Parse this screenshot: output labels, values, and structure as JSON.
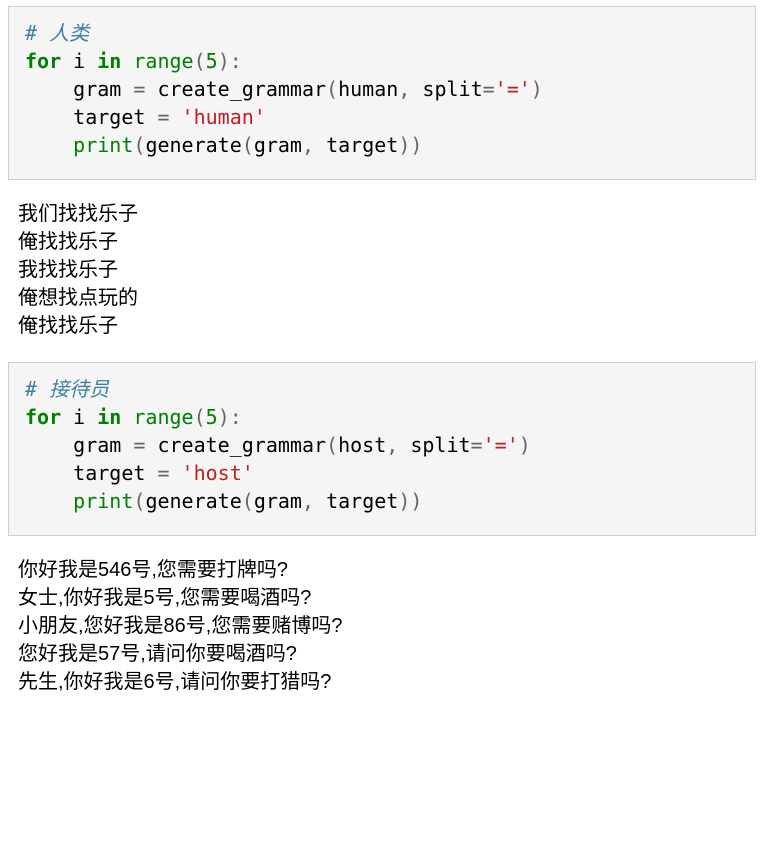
{
  "cells": [
    {
      "type": "code",
      "tokens": [
        {
          "cls": "c-comment",
          "text": "# 人类"
        },
        {
          "cls": "br"
        },
        {
          "cls": "c-keyword",
          "text": "for"
        },
        {
          "cls": "c-name",
          "text": " i "
        },
        {
          "cls": "c-keyword",
          "text": "in"
        },
        {
          "cls": "c-name",
          "text": " "
        },
        {
          "cls": "c-builtin",
          "text": "range"
        },
        {
          "cls": "c-op",
          "text": "("
        },
        {
          "cls": "c-number",
          "text": "5"
        },
        {
          "cls": "c-op",
          "text": "):"
        },
        {
          "cls": "br"
        },
        {
          "cls": "c-name",
          "text": "    gram "
        },
        {
          "cls": "c-op",
          "text": "="
        },
        {
          "cls": "c-name",
          "text": " create_grammar"
        },
        {
          "cls": "c-op",
          "text": "("
        },
        {
          "cls": "c-name",
          "text": "human"
        },
        {
          "cls": "c-op",
          "text": ","
        },
        {
          "cls": "c-name",
          "text": " split"
        },
        {
          "cls": "c-op",
          "text": "="
        },
        {
          "cls": "c-string",
          "text": "'='"
        },
        {
          "cls": "c-op",
          "text": ")"
        },
        {
          "cls": "br"
        },
        {
          "cls": "c-name",
          "text": "    target "
        },
        {
          "cls": "c-op",
          "text": "="
        },
        {
          "cls": "c-name",
          "text": " "
        },
        {
          "cls": "c-string",
          "text": "'human'"
        },
        {
          "cls": "br"
        },
        {
          "cls": "c-name",
          "text": "    "
        },
        {
          "cls": "c-builtin",
          "text": "print"
        },
        {
          "cls": "c-op",
          "text": "("
        },
        {
          "cls": "c-name",
          "text": "generate"
        },
        {
          "cls": "c-op",
          "text": "("
        },
        {
          "cls": "c-name",
          "text": "gram"
        },
        {
          "cls": "c-op",
          "text": ","
        },
        {
          "cls": "c-name",
          "text": " target"
        },
        {
          "cls": "c-op",
          "text": "))"
        }
      ]
    },
    {
      "type": "output",
      "lines": [
        "我们找找乐子",
        "俺找找乐子",
        "我找找乐子",
        "俺想找点玩的",
        "俺找找乐子"
      ]
    },
    {
      "type": "code",
      "tokens": [
        {
          "cls": "c-comment",
          "text": "# 接待员"
        },
        {
          "cls": "br"
        },
        {
          "cls": "c-keyword",
          "text": "for"
        },
        {
          "cls": "c-name",
          "text": " i "
        },
        {
          "cls": "c-keyword",
          "text": "in"
        },
        {
          "cls": "c-name",
          "text": " "
        },
        {
          "cls": "c-builtin",
          "text": "range"
        },
        {
          "cls": "c-op",
          "text": "("
        },
        {
          "cls": "c-number",
          "text": "5"
        },
        {
          "cls": "c-op",
          "text": "):"
        },
        {
          "cls": "br"
        },
        {
          "cls": "c-name",
          "text": "    gram "
        },
        {
          "cls": "c-op",
          "text": "="
        },
        {
          "cls": "c-name",
          "text": " create_grammar"
        },
        {
          "cls": "c-op",
          "text": "("
        },
        {
          "cls": "c-name",
          "text": "host"
        },
        {
          "cls": "c-op",
          "text": ","
        },
        {
          "cls": "c-name",
          "text": " split"
        },
        {
          "cls": "c-op",
          "text": "="
        },
        {
          "cls": "c-string",
          "text": "'='"
        },
        {
          "cls": "c-op",
          "text": ")"
        },
        {
          "cls": "br"
        },
        {
          "cls": "c-name",
          "text": "    target "
        },
        {
          "cls": "c-op",
          "text": "="
        },
        {
          "cls": "c-name",
          "text": " "
        },
        {
          "cls": "c-string",
          "text": "'host'"
        },
        {
          "cls": "br"
        },
        {
          "cls": "c-name",
          "text": "    "
        },
        {
          "cls": "c-builtin",
          "text": "print"
        },
        {
          "cls": "c-op",
          "text": "("
        },
        {
          "cls": "c-name",
          "text": "generate"
        },
        {
          "cls": "c-op",
          "text": "("
        },
        {
          "cls": "c-name",
          "text": "gram"
        },
        {
          "cls": "c-op",
          "text": ","
        },
        {
          "cls": "c-name",
          "text": " target"
        },
        {
          "cls": "c-op",
          "text": "))"
        }
      ]
    },
    {
      "type": "output",
      "lines": [
        "你好我是546号,您需要打牌吗?",
        "女士,你好我是5号,您需要喝酒吗?",
        "小朋友,您好我是86号,您需要赌博吗?",
        "您好我是57号,请问你要喝酒吗?",
        "先生,你好我是6号,请问你要打猎吗?"
      ]
    }
  ]
}
